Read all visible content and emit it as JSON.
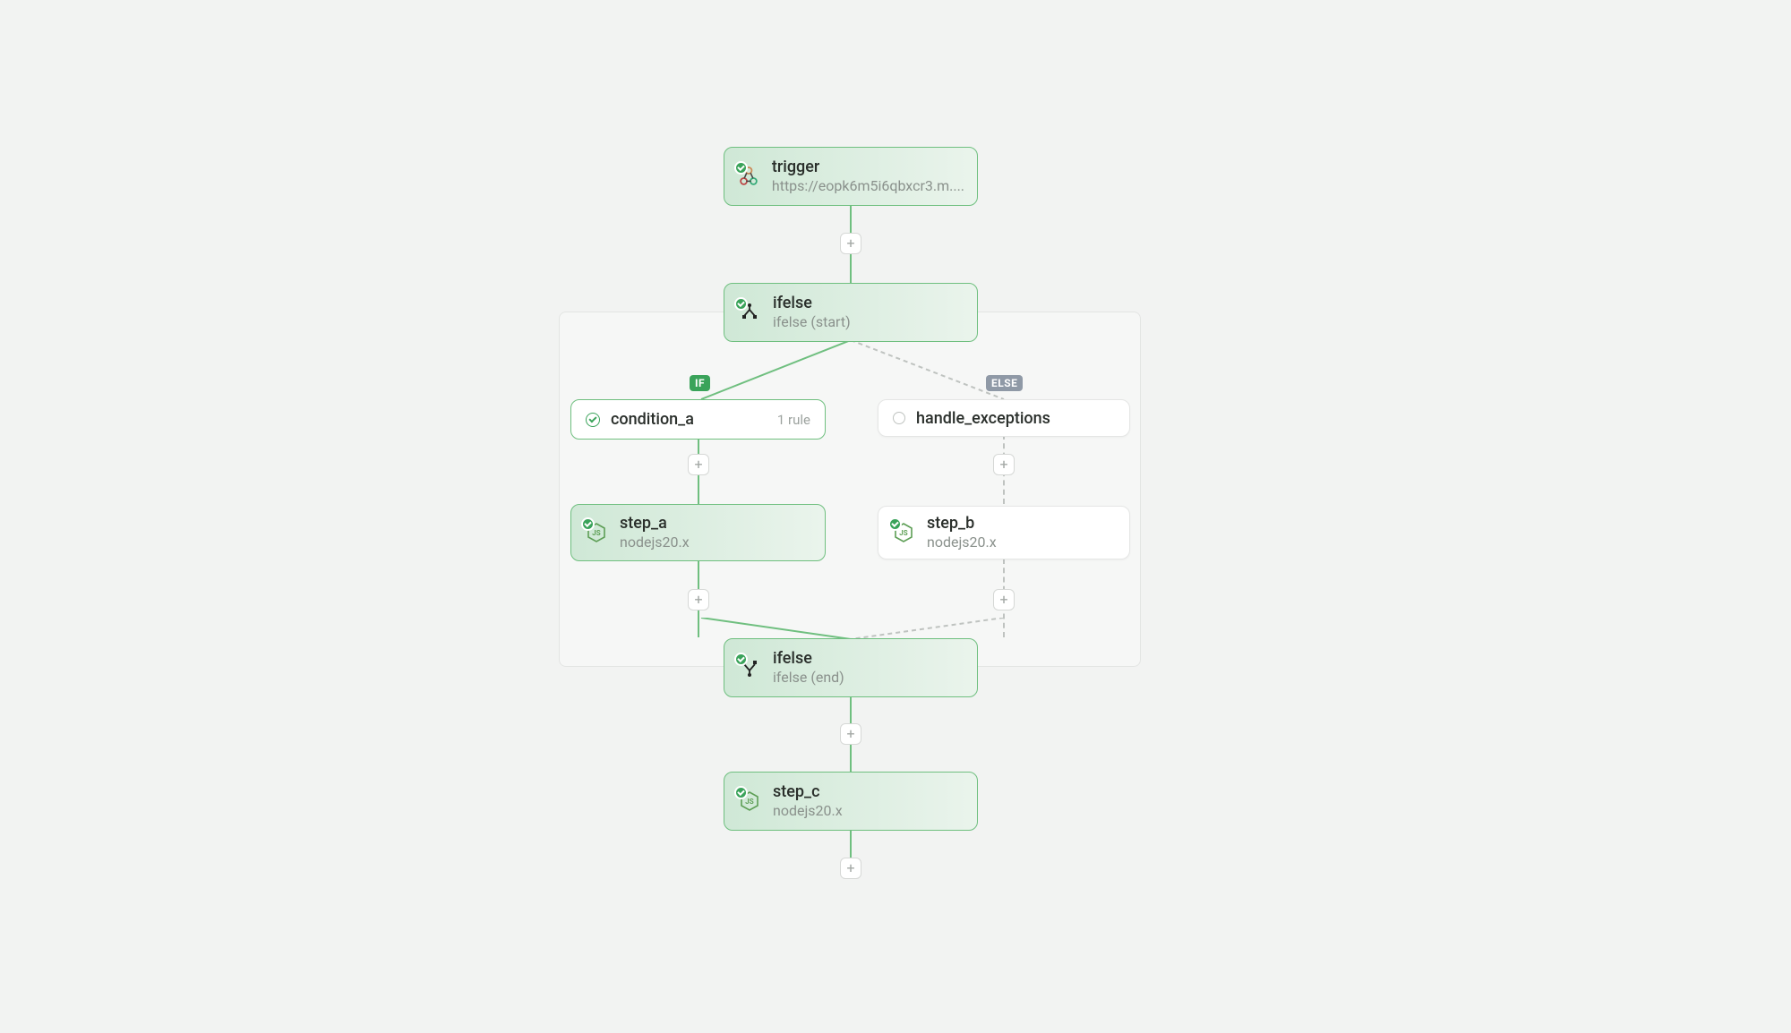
{
  "nodes": {
    "trigger": {
      "title": "trigger",
      "subtitle": "https://eopk6m5i6qbxcr3.m...."
    },
    "ifelse_start": {
      "title": "ifelse",
      "subtitle": "ifelse (start)"
    },
    "condition_a": {
      "title": "condition_a",
      "rule_count": "1 rule"
    },
    "handle_exceptions": {
      "title": "handle_exceptions"
    },
    "step_a": {
      "title": "step_a",
      "subtitle": "nodejs20.x"
    },
    "step_b": {
      "title": "step_b",
      "subtitle": "nodejs20.x"
    },
    "ifelse_end": {
      "title": "ifelse",
      "subtitle": "ifelse (end)"
    },
    "step_c": {
      "title": "step_c",
      "subtitle": "nodejs20.x"
    }
  },
  "tags": {
    "if": "IF",
    "else": "ELSE"
  },
  "plus": "+"
}
